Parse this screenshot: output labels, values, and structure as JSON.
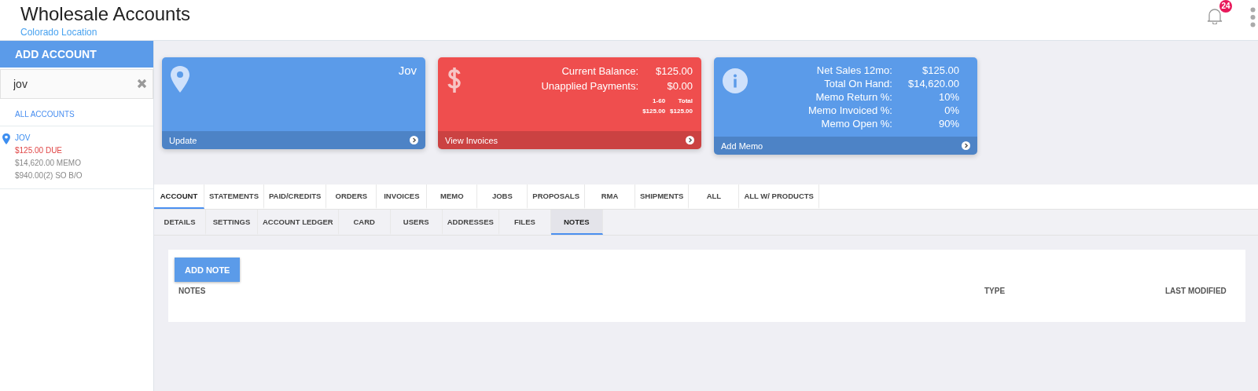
{
  "header": {
    "title": "Wholesale Accounts",
    "subtitle": "Colorado Location",
    "notifications": "24"
  },
  "sidebar": {
    "add_button": "ADD ACCOUNT",
    "search": {
      "value": "jov"
    },
    "all_link": "ALL ACCOUNTS",
    "accounts": [
      {
        "name": "JOV",
        "due": "$125.00 DUE",
        "memo": "$14,620.00 MEMO",
        "backorder": "$940.00(2) SO B/O"
      }
    ]
  },
  "cards": [
    {
      "kind": "location",
      "color": "#5b9be9",
      "title": "Jov",
      "footer": "Update"
    },
    {
      "kind": "balance",
      "color": "#ef4e4e",
      "rows": [
        {
          "label": "Current Balance:",
          "value": "$125.00"
        },
        {
          "label": "Unapplied Payments:",
          "value": "$0.00"
        }
      ],
      "aging": {
        "columns": [
          "1-60",
          "Total"
        ],
        "values": [
          "$125.00",
          "$125.00"
        ]
      },
      "footer": "View Invoices"
    },
    {
      "kind": "info",
      "color": "#5b9be9",
      "rows": [
        {
          "label": "Net Sales 12mo:",
          "value": "$125.00"
        },
        {
          "label": "Total On Hand:",
          "value": "$14,620.00"
        },
        {
          "label": "Memo Return %:",
          "value": "10%"
        },
        {
          "label": "Memo Invoiced %:",
          "value": "0%"
        },
        {
          "label": "Memo Open %:",
          "value": "90%"
        }
      ],
      "footer": "Add Memo"
    }
  ],
  "tabs": [
    {
      "label": "ACCOUNT",
      "selected": true
    },
    {
      "label": "STATEMENTS",
      "selected": false
    },
    {
      "label": "PAID/CREDITS",
      "selected": false
    },
    {
      "label": "ORDERS",
      "selected": false
    },
    {
      "label": "INVOICES",
      "selected": false
    },
    {
      "label": "MEMO",
      "selected": false
    },
    {
      "label": "JOBS",
      "selected": false
    },
    {
      "label": "PROPOSALS",
      "selected": false
    },
    {
      "label": "RMA",
      "selected": false
    },
    {
      "label": "SHIPMENTS",
      "selected": false
    },
    {
      "label": "ALL",
      "selected": false
    },
    {
      "label": "ALL W/ PRODUCTS",
      "selected": false
    }
  ],
  "subtabs": [
    {
      "label": "DETAILS",
      "selected": false
    },
    {
      "label": "SETTINGS",
      "selected": false
    },
    {
      "label": "ACCOUNT LEDGER",
      "selected": false
    },
    {
      "label": "CARD",
      "selected": false
    },
    {
      "label": "USERS",
      "selected": false
    },
    {
      "label": "ADDRESSES",
      "selected": false
    },
    {
      "label": "FILES",
      "selected": false
    },
    {
      "label": "NOTES",
      "selected": true
    }
  ],
  "notes": {
    "add_button": "ADD NOTE",
    "columns": [
      "NOTES",
      "TYPE",
      "LAST MODIFIED"
    ]
  }
}
